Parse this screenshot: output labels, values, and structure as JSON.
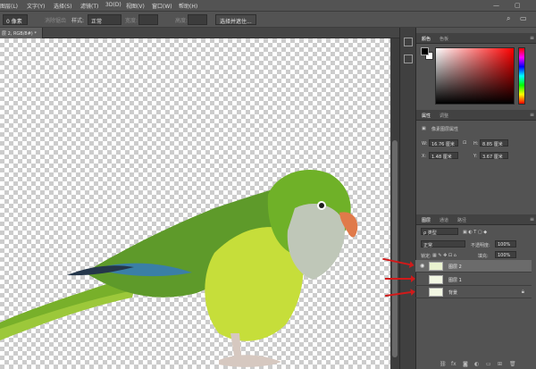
{
  "menubar": {
    "items": [
      "图层(L)",
      "文字(Y)",
      "选择(S)",
      "滤镜(T)",
      "3D(D)",
      "视图(V)",
      "窗口(W)",
      "帮助(H)"
    ],
    "search_icon": "search-icon",
    "window_controls": [
      "—",
      "▢"
    ]
  },
  "options": {
    "feather_value": "0 像素",
    "antialias_label": "消除锯齿",
    "style_label": "样式:",
    "style_value": "正常",
    "width_label": "宽度:",
    "height_label": "高度:",
    "select_mask_button": "选择并遮住..."
  },
  "document": {
    "tab_title": "层 2, RGB/8#) *",
    "tab_close": "×"
  },
  "color_panel": {
    "tabs": [
      "颜色",
      "色板"
    ],
    "fg_color": "#000000",
    "bg_color": "#ffffff"
  },
  "properties_panel": {
    "tabs": [
      "属性",
      "调整"
    ],
    "subtitle": "像素图层属性",
    "w_label": "W:",
    "w_value": "16.76 厘米",
    "h_label": "H:",
    "h_value": "8.85 厘米",
    "x_label": "X:",
    "x_value": "1.48 厘米",
    "y_label": "Y:",
    "y_value": "3.67 厘米"
  },
  "layers_panel": {
    "tabs": [
      "图层",
      "通道",
      "路径"
    ],
    "filter_label": "ρ 类型",
    "blend_mode": "正常",
    "opacity_label": "不透明度:",
    "opacity_value": "100%",
    "lock_label": "锁定:",
    "fill_label": "填充:",
    "fill_value": "100%",
    "layers": [
      {
        "name": "图层 2",
        "visible": true,
        "selected": true
      },
      {
        "name": "图层 1",
        "visible": false,
        "selected": false
      },
      {
        "name": "背景",
        "visible": false,
        "selected": false,
        "locked": true
      }
    ],
    "footer_icons": [
      "link-icon",
      "fx-icon",
      "mask-icon",
      "adjustment-icon",
      "folder-icon",
      "new-layer-icon",
      "trash-icon"
    ]
  },
  "colors": {
    "annotation_arrow": "#d11a1a",
    "ui_bg": "#535353"
  }
}
